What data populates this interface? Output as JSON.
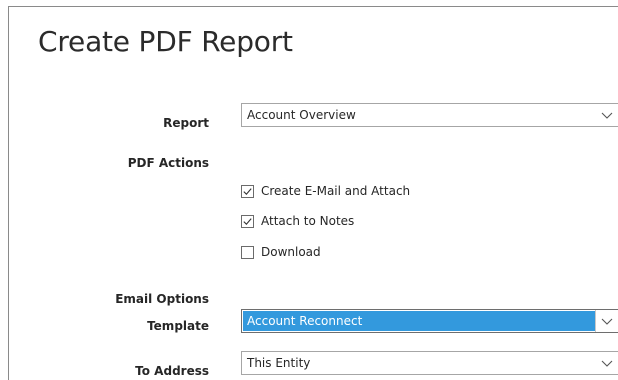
{
  "title": "Create PDF Report",
  "report": {
    "label": "Report",
    "value": "Account Overview"
  },
  "pdf_actions": {
    "label": "PDF Actions",
    "options": [
      {
        "label": "Create E-Mail and Attach",
        "checked": true
      },
      {
        "label": "Attach to Notes",
        "checked": true
      },
      {
        "label": "Download",
        "checked": false
      }
    ]
  },
  "email_options": {
    "label": "Email Options",
    "template": {
      "label": "Template",
      "value": "Account Reconnect"
    },
    "to_address": {
      "label": "To Address",
      "value": "This Entity"
    }
  },
  "colors": {
    "highlight": "#3399dd",
    "border": "#a6a6a6"
  },
  "icons": {
    "dropdown": "chevron-down-icon",
    "check": "checkmark-icon"
  }
}
